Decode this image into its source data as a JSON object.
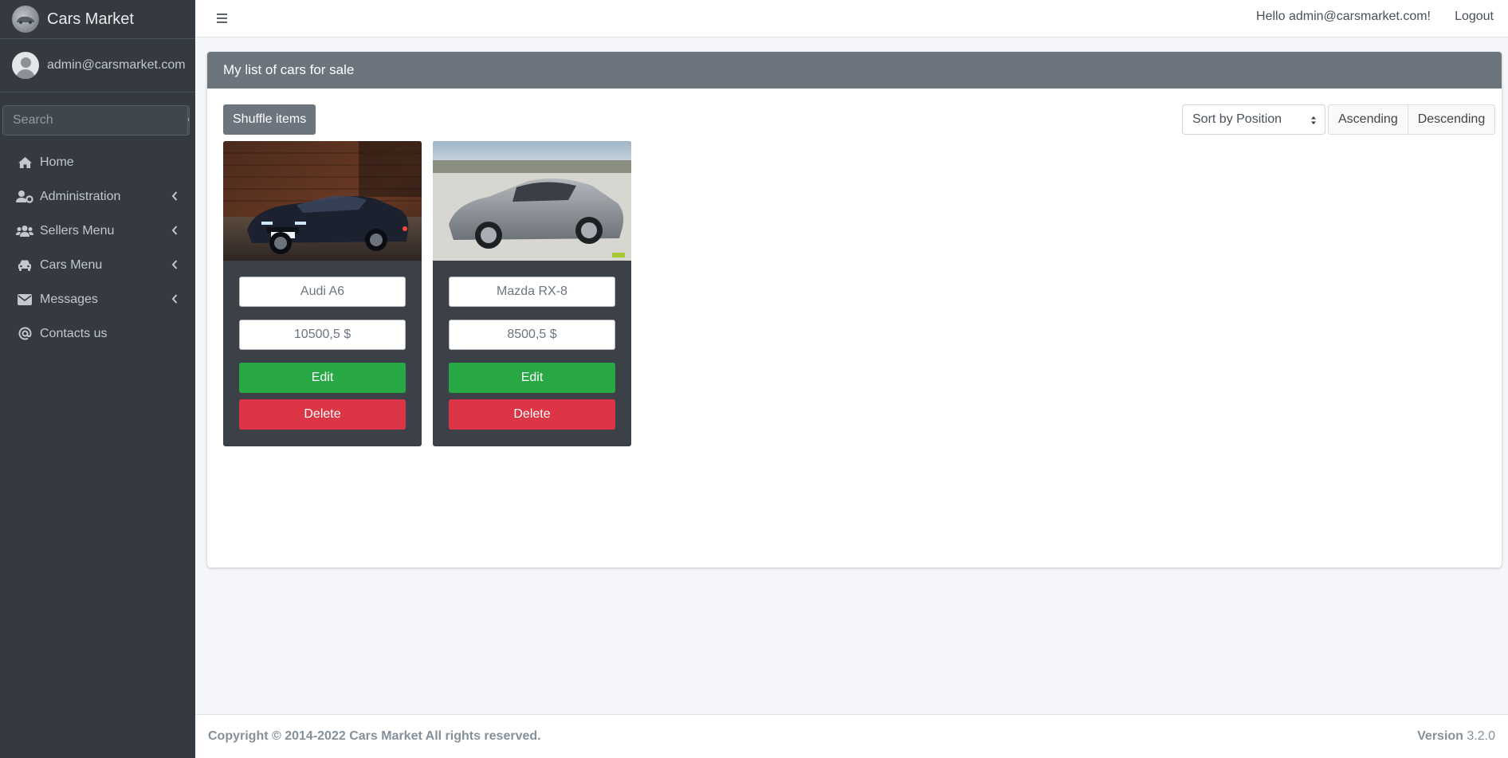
{
  "brand": {
    "name": "Cars Market"
  },
  "user": {
    "email": "admin@carsmarket.com"
  },
  "search": {
    "placeholder": "Search"
  },
  "nav": {
    "items": [
      {
        "label": "Home",
        "icon": "home-icon"
      },
      {
        "label": "Administration",
        "icon": "user-cog-icon"
      },
      {
        "label": "Sellers Menu",
        "icon": "users-icon"
      },
      {
        "label": "Cars Menu",
        "icon": "car-icon"
      },
      {
        "label": "Messages",
        "icon": "envelope-icon"
      },
      {
        "label": "Contacts us",
        "icon": "at-icon"
      }
    ]
  },
  "topbar": {
    "greeting": "Hello admin@carsmarket.com!",
    "logout": "Logout"
  },
  "card": {
    "title": "My list of cars for sale",
    "shuffle_label": "Shuffle items",
    "sort_label": "Sort by Position",
    "ascending_label": "Ascending",
    "descending_label": "Descending"
  },
  "cars": [
    {
      "name": "Audi A6",
      "price": "10500,5 $",
      "edit_label": "Edit",
      "delete_label": "Delete"
    },
    {
      "name": "Mazda RX-8",
      "price": "8500,5 $",
      "edit_label": "Edit",
      "delete_label": "Delete"
    }
  ],
  "footer": {
    "copyright": "Copyright © 2014-2022 Cars Market All rights reserved.",
    "version_label": "Version",
    "version_number": "3.2.0"
  },
  "colors": {
    "sidebar": "#343a40",
    "header": "#6c757d",
    "edit": "#28a745",
    "delete": "#dc3545"
  }
}
